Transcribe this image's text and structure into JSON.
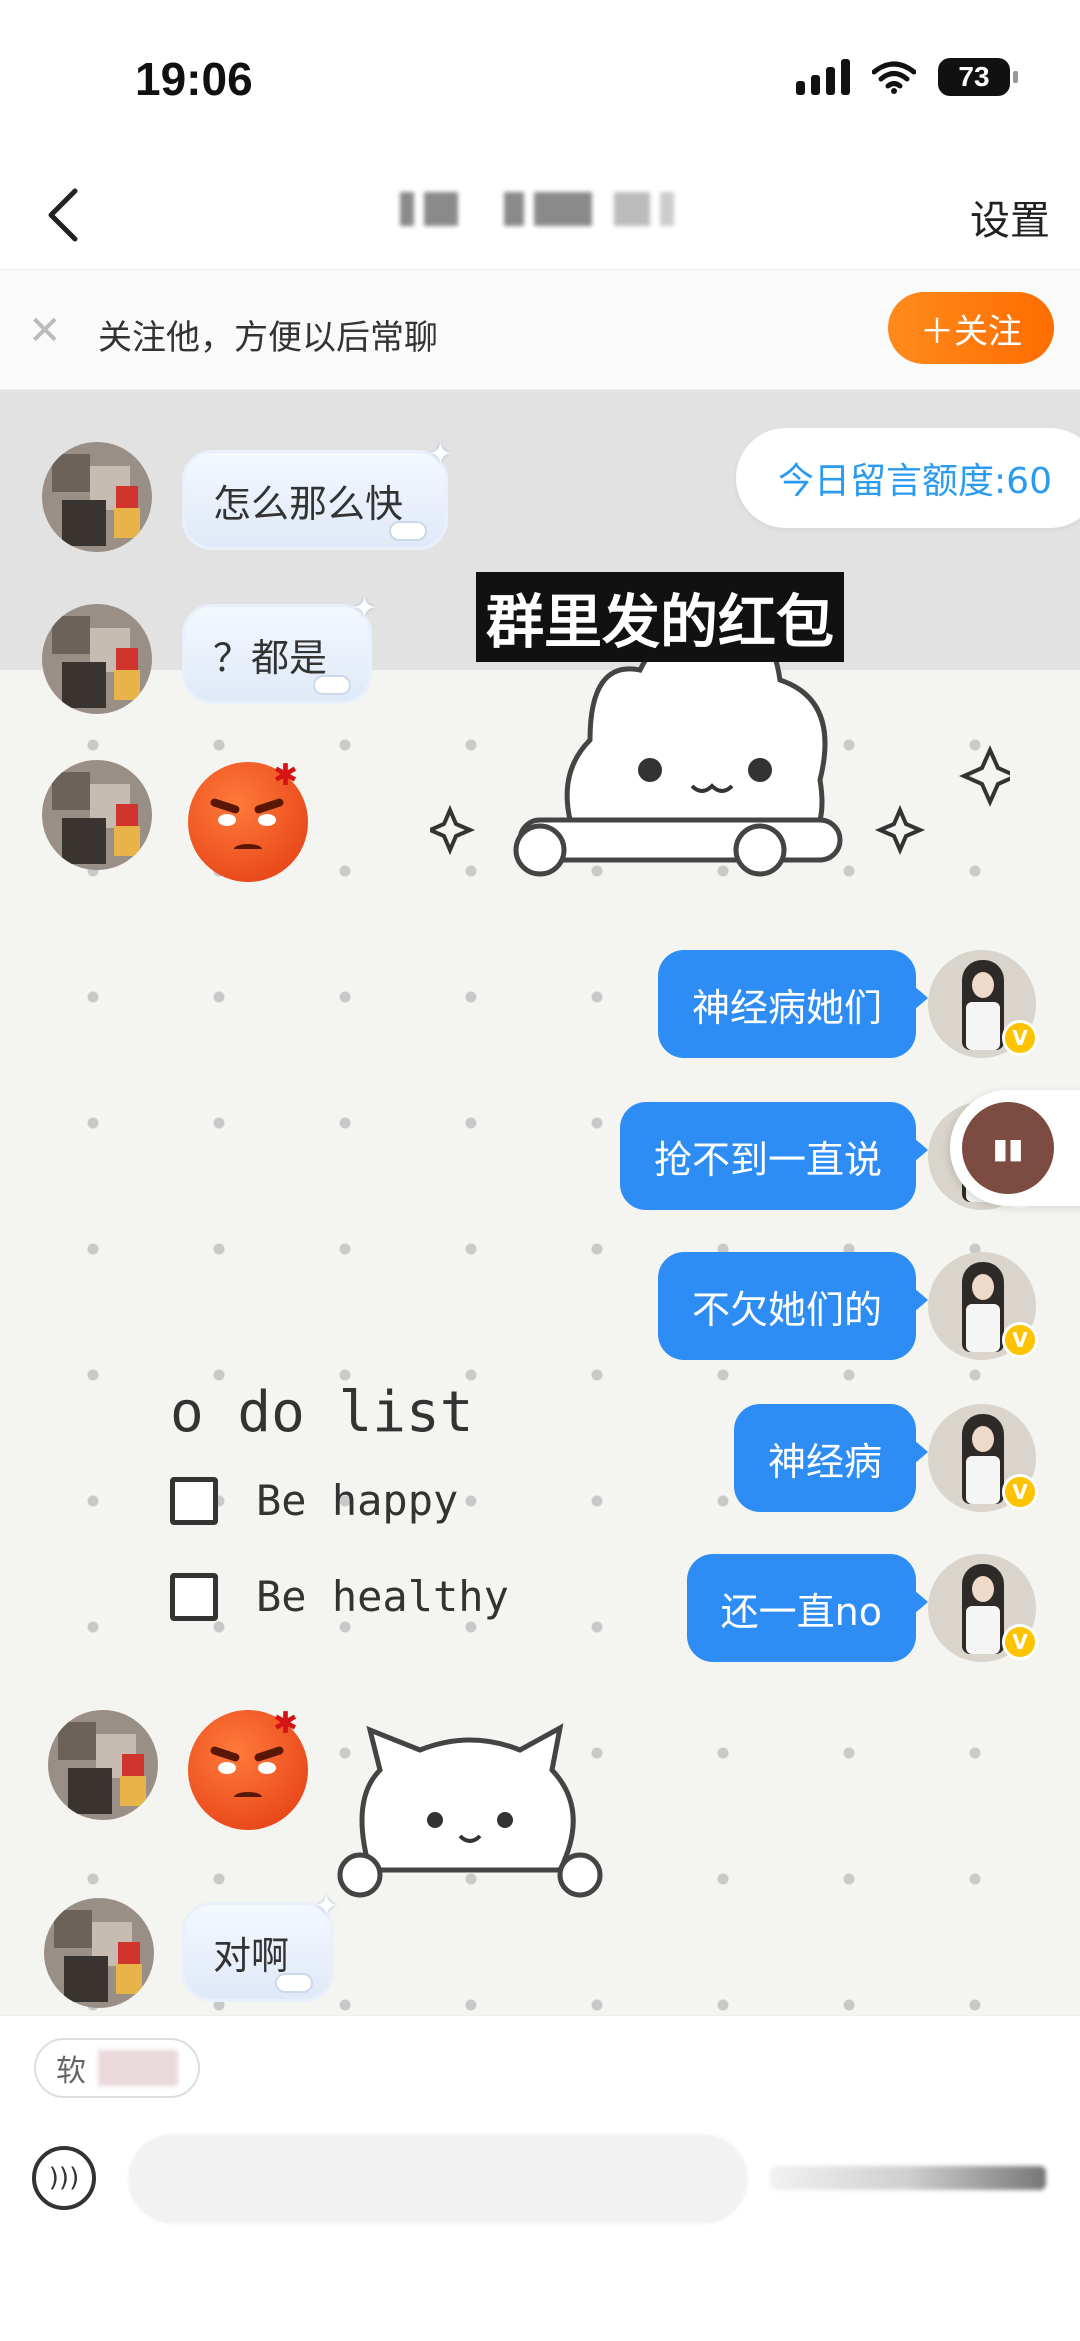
{
  "status_bar": {
    "time": "19:06",
    "battery": "73"
  },
  "header": {
    "settings": "设置"
  },
  "follow_bar": {
    "text": "关注他，方便以后常聊",
    "button": "＋关注"
  },
  "chat": {
    "quota": "今日留言额度:60",
    "overlay_caption": "群里发的红包",
    "messages": [
      {
        "from": "other",
        "type": "text",
        "text": "怎么那么快"
      },
      {
        "from": "other",
        "type": "text",
        "text": "？都是"
      },
      {
        "from": "other",
        "type": "sticker",
        "sticker": "angry-face"
      },
      {
        "from": "me",
        "type": "text",
        "text": "神经病她们"
      },
      {
        "from": "me",
        "type": "text",
        "text": "抢不到一直说"
      },
      {
        "from": "me",
        "type": "text",
        "text": "不欠她们的"
      },
      {
        "from": "me",
        "type": "text",
        "text": "神经病"
      },
      {
        "from": "me",
        "type": "text",
        "text": "还一直no"
      },
      {
        "from": "other",
        "type": "sticker",
        "sticker": "angry-face"
      },
      {
        "from": "other",
        "type": "text",
        "text": "对啊"
      }
    ],
    "todo": {
      "title": "o do list",
      "items": [
        "Be happy",
        "Be healthy"
      ]
    }
  },
  "bottom": {
    "chip_label": "软"
  },
  "colors": {
    "accent_blue": "#2d8df5",
    "follow_orange": "#ff7a10",
    "quota_blue": "#2a9bf1"
  }
}
